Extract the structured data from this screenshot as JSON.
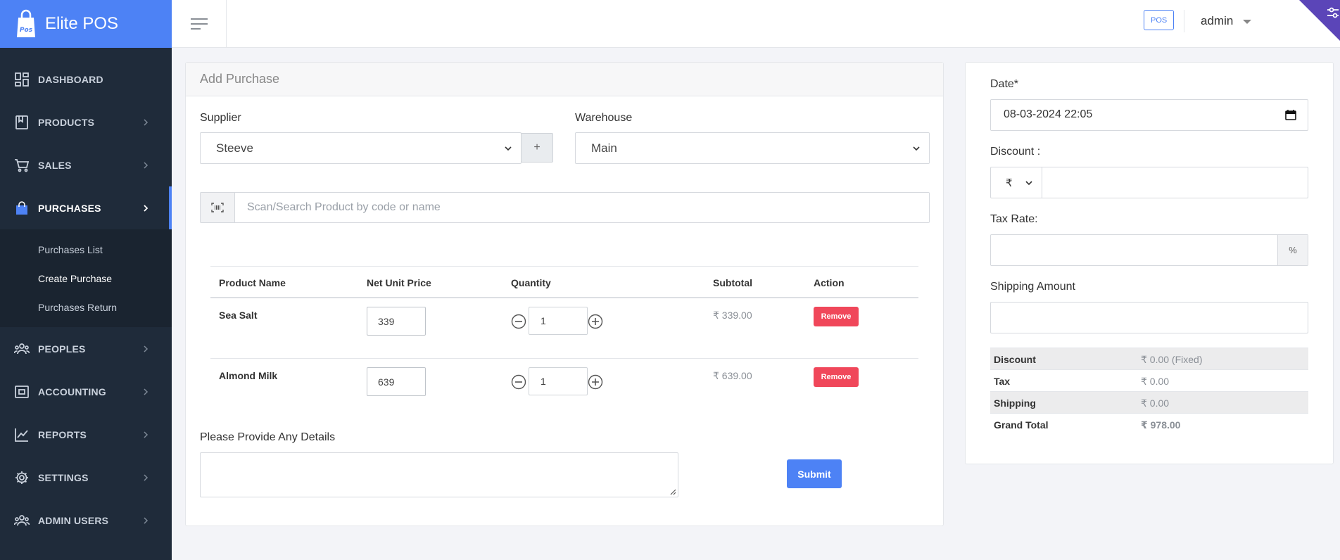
{
  "app": {
    "name": "Elite POS"
  },
  "sidebar": {
    "items": [
      {
        "label": "DASHBOARD",
        "icon": "dashboard-icon",
        "chevron": false
      },
      {
        "label": "PRODUCTS",
        "icon": "bookmark-icon",
        "chevron": true
      },
      {
        "label": "SALES",
        "icon": "cart-icon",
        "chevron": true
      },
      {
        "label": "PURCHASES",
        "icon": "shopping-bag-icon",
        "chevron": true,
        "active": true
      },
      {
        "label": "PEOPLES",
        "icon": "people-icon",
        "chevron": true
      },
      {
        "label": "ACCOUNTING",
        "icon": "wallet-icon",
        "chevron": true
      },
      {
        "label": "REPORTS",
        "icon": "chart-line-icon",
        "chevron": true
      },
      {
        "label": "SETTINGS",
        "icon": "gear-icon",
        "chevron": true
      },
      {
        "label": "ADMIN USERS",
        "icon": "users-icon",
        "chevron": true
      }
    ],
    "purchases_submenu": [
      "Purchases List",
      "Create Purchase",
      "Purchases Return"
    ]
  },
  "header": {
    "pos_label": "POS",
    "user": "admin"
  },
  "form": {
    "title": "Add Purchase",
    "supplier_label": "Supplier",
    "supplier_value": "Steeve",
    "add_supplier_label": "+",
    "warehouse_label": "Warehouse",
    "warehouse_value": "Main",
    "search_placeholder": "Scan/Search Product by code or name",
    "table": {
      "headers": [
        "Product Name",
        "Net Unit Price",
        "Quantity",
        "Subtotal",
        "Action"
      ],
      "rows": [
        {
          "name": "Sea Salt",
          "price": "339",
          "qty": "1",
          "subtotal": "₹ 339.00",
          "action": "Remove"
        },
        {
          "name": "Almond Milk",
          "price": "639",
          "qty": "1",
          "subtotal": "₹ 639.00",
          "action": "Remove"
        }
      ]
    },
    "details_label": "Please Provide Any Details",
    "submit_label": "Submit"
  },
  "side": {
    "date_label": "Date*",
    "date_value": "08-03-2024 22:05",
    "discount_label": "Discount :",
    "currency": "₹",
    "tax_label": "Tax Rate:",
    "tax_addon": "%",
    "shipping_label": "Shipping Amount",
    "summary": [
      {
        "k": "Discount",
        "v": "₹ 0.00 (Fixed)"
      },
      {
        "k": "Tax",
        "v": "₹ 0.00"
      },
      {
        "k": "Shipping",
        "v": "₹ 0.00"
      },
      {
        "k": "Grand Total",
        "v": "₹ 978.00"
      }
    ]
  },
  "colors": {
    "primary": "#4d82f5",
    "sidebar": "#1f2b3a",
    "danger": "#f0475a",
    "corner": "#5b45b8"
  }
}
